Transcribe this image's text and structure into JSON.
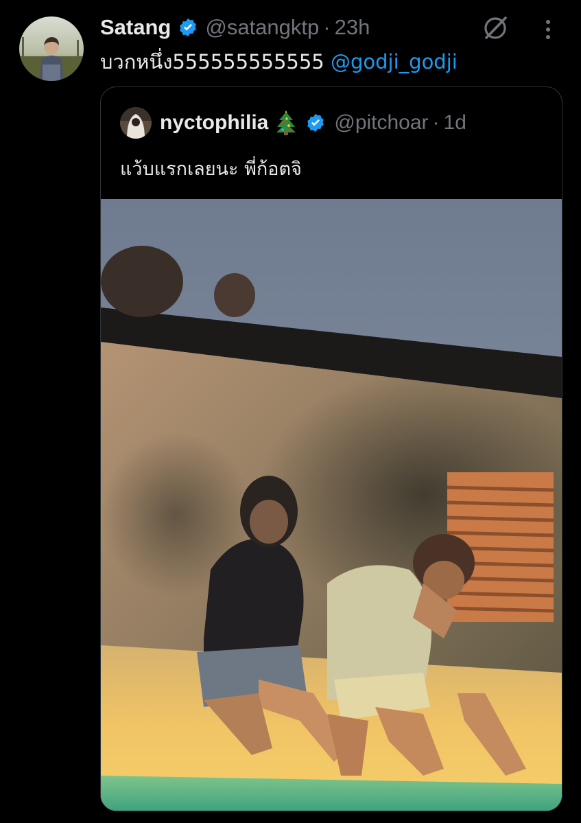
{
  "tweet": {
    "author": {
      "display_name": "Satang",
      "handle": "@satangktp",
      "avatar_icon": "profile-photo",
      "verified": true
    },
    "separator": "·",
    "time": "23h",
    "text": "บวกหนึ่ง555555555555",
    "mention": "@godji_godji",
    "icons": {
      "grok": "grok-icon",
      "more": "more-vertical-icon"
    }
  },
  "quote": {
    "author": {
      "display_name": "nyctophilia",
      "emoji": "christmas-tree-icon",
      "handle": "@pitchoar",
      "verified": true
    },
    "separator": "·",
    "time": "1d",
    "text": "แว้บแรกเลยนะ พี่ก้อตจิ",
    "media": "photo"
  },
  "colors": {
    "background": "#000000",
    "text_primary": "#e7e9ea",
    "text_secondary": "#71767b",
    "accent": "#1d9bf0",
    "border": "#2f3336"
  }
}
